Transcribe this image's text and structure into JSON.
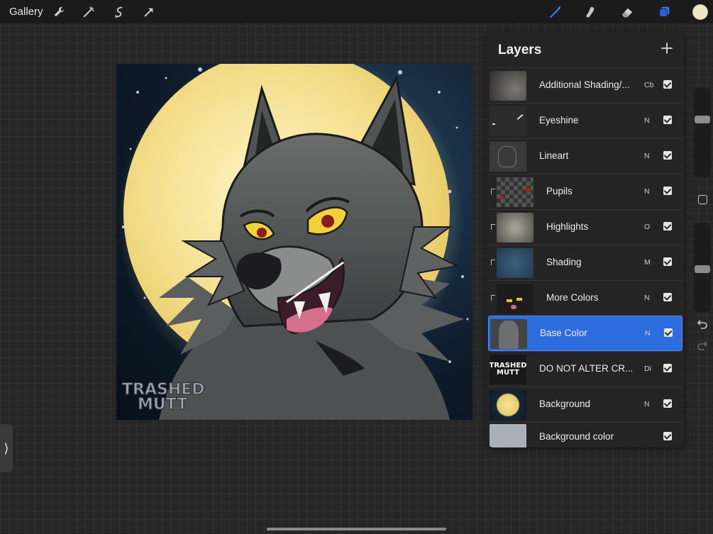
{
  "topbar": {
    "gallery_label": "Gallery",
    "tools_left": [
      "wrench-icon",
      "magic-wand-icon",
      "selection-icon",
      "transform-icon"
    ],
    "tools_right": [
      "brush-icon",
      "smudge-icon",
      "eraser-icon",
      "layers-icon"
    ],
    "active_color": "#f1e6c8"
  },
  "artwork": {
    "watermark_line1": "TRASHED",
    "watermark_line2": "MUTT"
  },
  "layers": {
    "title": "Layers",
    "items": [
      {
        "name": "Additional Shading/...",
        "mode": "Cb",
        "visible": true,
        "clipped": false
      },
      {
        "name": "Eyeshine",
        "mode": "N",
        "visible": true,
        "clipped": false
      },
      {
        "name": "Lineart",
        "mode": "N",
        "visible": true,
        "clipped": false
      },
      {
        "name": "Pupils",
        "mode": "N",
        "visible": true,
        "clipped": true
      },
      {
        "name": "Highlights",
        "mode": "O",
        "visible": true,
        "clipped": true
      },
      {
        "name": "Shading",
        "mode": "M",
        "visible": true,
        "clipped": true
      },
      {
        "name": "More Colors",
        "mode": "N",
        "visible": true,
        "clipped": true
      },
      {
        "name": "Base Color",
        "mode": "N",
        "visible": true,
        "clipped": false,
        "selected": true
      },
      {
        "name": "DO NOT ALTER CR...",
        "mode": "Di",
        "visible": true,
        "clipped": false
      },
      {
        "name": "Background",
        "mode": "N",
        "visible": true,
        "clipped": false
      },
      {
        "name": "Background color",
        "mode": "",
        "visible": true,
        "clipped": false
      }
    ]
  },
  "sidebar": {
    "brush_size": 0.22,
    "brush_opacity": 0.52
  },
  "colors": {
    "accent": "#2d6cdf",
    "panel": "#242424",
    "toolbar": "#1b1b1b"
  }
}
